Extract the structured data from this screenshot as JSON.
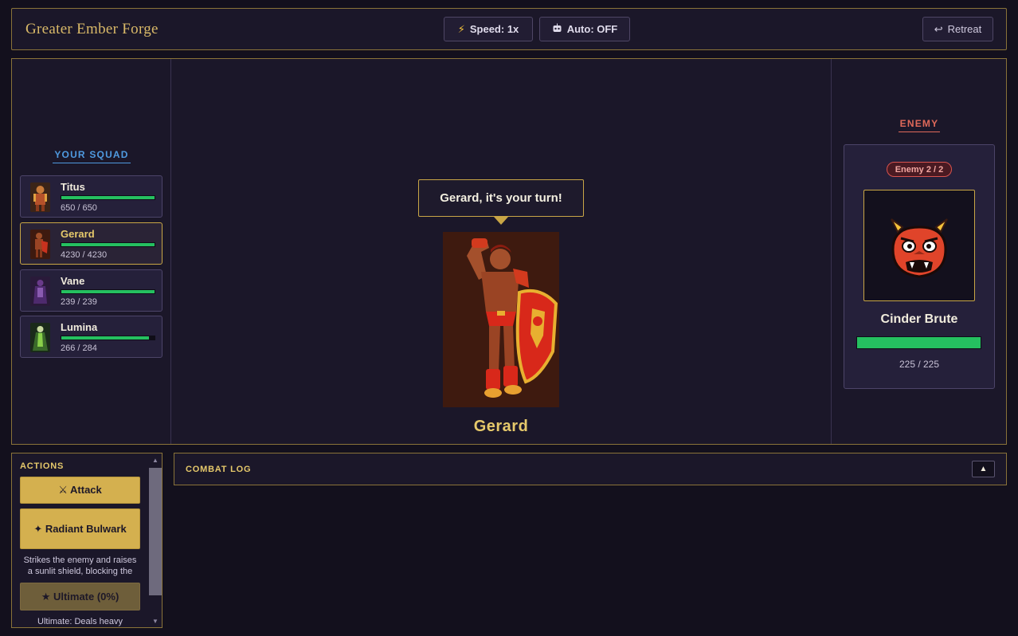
{
  "header": {
    "title": "Greater Ember Forge",
    "speed_label": "Speed: 1x",
    "auto_label": "Auto: OFF",
    "retreat_label": "Retreat"
  },
  "squad": {
    "heading": "YOUR SQUAD",
    "units": [
      {
        "name": "Titus",
        "hp_text": "650 / 650",
        "hp_fraction": 1.0,
        "active": false
      },
      {
        "name": "Gerard",
        "hp_text": "4230 / 4230",
        "hp_fraction": 1.0,
        "active": true
      },
      {
        "name": "Vane",
        "hp_text": "239 / 239",
        "hp_fraction": 1.0,
        "active": false
      },
      {
        "name": "Lumina",
        "hp_text": "266 / 284",
        "hp_fraction": 0.937,
        "active": false
      }
    ]
  },
  "battle": {
    "turn_message": "Gerard, it's your turn!",
    "active_hero": "Gerard"
  },
  "enemy": {
    "heading": "ENEMY",
    "counter": "Enemy 2 / 2",
    "name": "Cinder Brute",
    "hp_text": "225 / 225",
    "hp_fraction": 1.0,
    "icon": "ogre-mask-icon"
  },
  "actions": {
    "heading": "ACTIONS",
    "attack_label": "⚔ Attack",
    "skill_label": "✦ Radiant Bulwark",
    "skill_desc": "Strikes the enemy and raises a sunlit shield, blocking the",
    "ultimate_label": "★ Ultimate (0%)",
    "ultimate_desc": "Ultimate: Deals heavy"
  },
  "log": {
    "label": "COMBAT LOG",
    "toggle": "▲"
  },
  "colors": {
    "gold": "#c9a646",
    "hp_green": "#25c060",
    "squad_blue": "#4f9ae0",
    "enemy_red": "#e0695a"
  }
}
